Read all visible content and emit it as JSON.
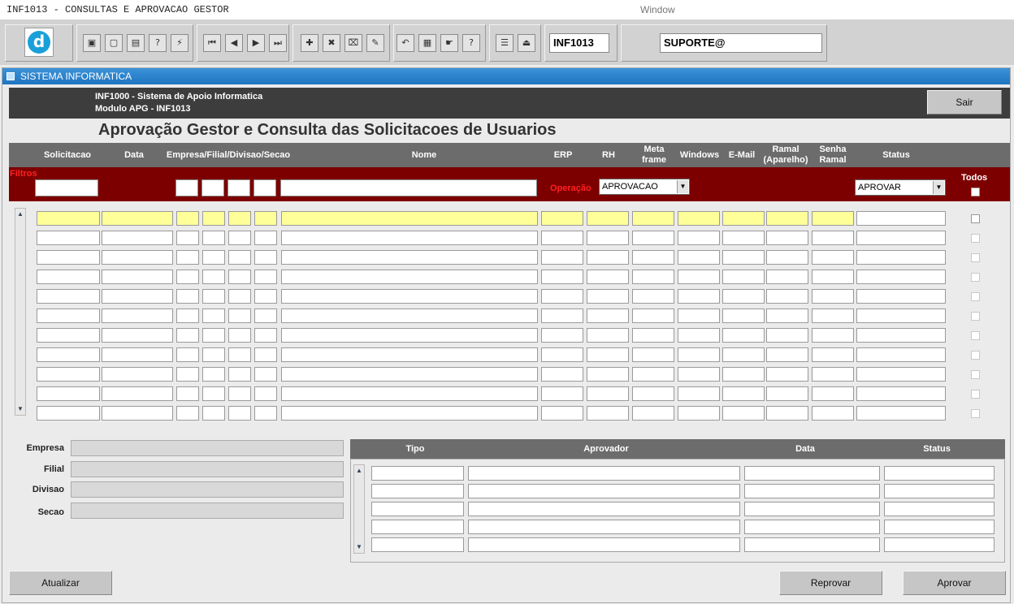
{
  "window": {
    "title": "INF1013 - CONSULTAS E APROVACAO GESTOR",
    "menu_label": "Window"
  },
  "toolbar": {
    "form_code": "INF1013",
    "user": "SUPORTE@",
    "logo_letter": "d",
    "buttons": [
      {
        "name": "save-icon",
        "glyph": "▣"
      },
      {
        "name": "window-icon",
        "glyph": "▢"
      },
      {
        "name": "print-icon",
        "glyph": "▤"
      },
      {
        "name": "query-icon",
        "glyph": "?"
      },
      {
        "name": "execute-query-icon",
        "glyph": "⚡"
      },
      {
        "name": "first-record-icon",
        "glyph": "⏮"
      },
      {
        "name": "previous-record-icon",
        "glyph": "◀"
      },
      {
        "name": "next-record-icon",
        "glyph": "▶"
      },
      {
        "name": "last-record-icon",
        "glyph": "⏭"
      },
      {
        "name": "insert-record-icon",
        "glyph": "✚"
      },
      {
        "name": "delete-record-icon",
        "glyph": "✖"
      },
      {
        "name": "clear-record-icon",
        "glyph": "⌧"
      },
      {
        "name": "edit-icon",
        "glyph": "✎"
      },
      {
        "name": "undo-icon",
        "glyph": "↶"
      },
      {
        "name": "clipboard-icon",
        "glyph": "▦"
      },
      {
        "name": "list-values-icon",
        "glyph": "☛"
      },
      {
        "name": "help-icon",
        "glyph": "?"
      },
      {
        "name": "menu-icon",
        "glyph": "☰"
      },
      {
        "name": "exit-icon",
        "glyph": "⏏"
      }
    ]
  },
  "panel": {
    "title": "SISTEMA INFORMATICA"
  },
  "app": {
    "line1": "INF1000 - Sistema de Apoio Informatica",
    "line2": "Modulo APG - INF1013",
    "exit_label": "Sair",
    "page_title": "Aprovação Gestor e Consulta das Solicitacoes de Usuarios"
  },
  "grid": {
    "headers": {
      "solicitacao": "Solicitacao",
      "data": "Data",
      "empresa": "Empresa/Filial/Divisao/Secao",
      "nome": "Nome",
      "erp": "ERP",
      "rh": "RH",
      "meta_1": "Meta",
      "meta_2": "frame",
      "windows": "Windows",
      "email": "E-Mail",
      "ramal_1": "Ramal",
      "ramal_2": "(Aparelho)",
      "senha_1": "Senha",
      "senha_2": "Ramal",
      "status": "Status"
    },
    "filters": {
      "label": "Filtros",
      "operacao_label": "Operação",
      "operacao_value": "APROVACAO",
      "status_value": "APROVAR",
      "todos_label": "Todos"
    }
  },
  "details": {
    "empresa": "Empresa",
    "filial": "Filial",
    "divisao": "Divisao",
    "secao": "Secao"
  },
  "approvals": {
    "headers": {
      "tipo": "Tipo",
      "aprovador": "Aprovador",
      "data": "Data",
      "status": "Status"
    }
  },
  "actions": {
    "atualizar": "Atualizar",
    "reprovar": "Reprovar",
    "aprovar": "Aprovar"
  },
  "colors": {
    "filter_bar": "#7d0000",
    "header_bar": "#3d3d3d",
    "highlight_row": "#ffff99",
    "panel_title": "#2a82cc"
  }
}
